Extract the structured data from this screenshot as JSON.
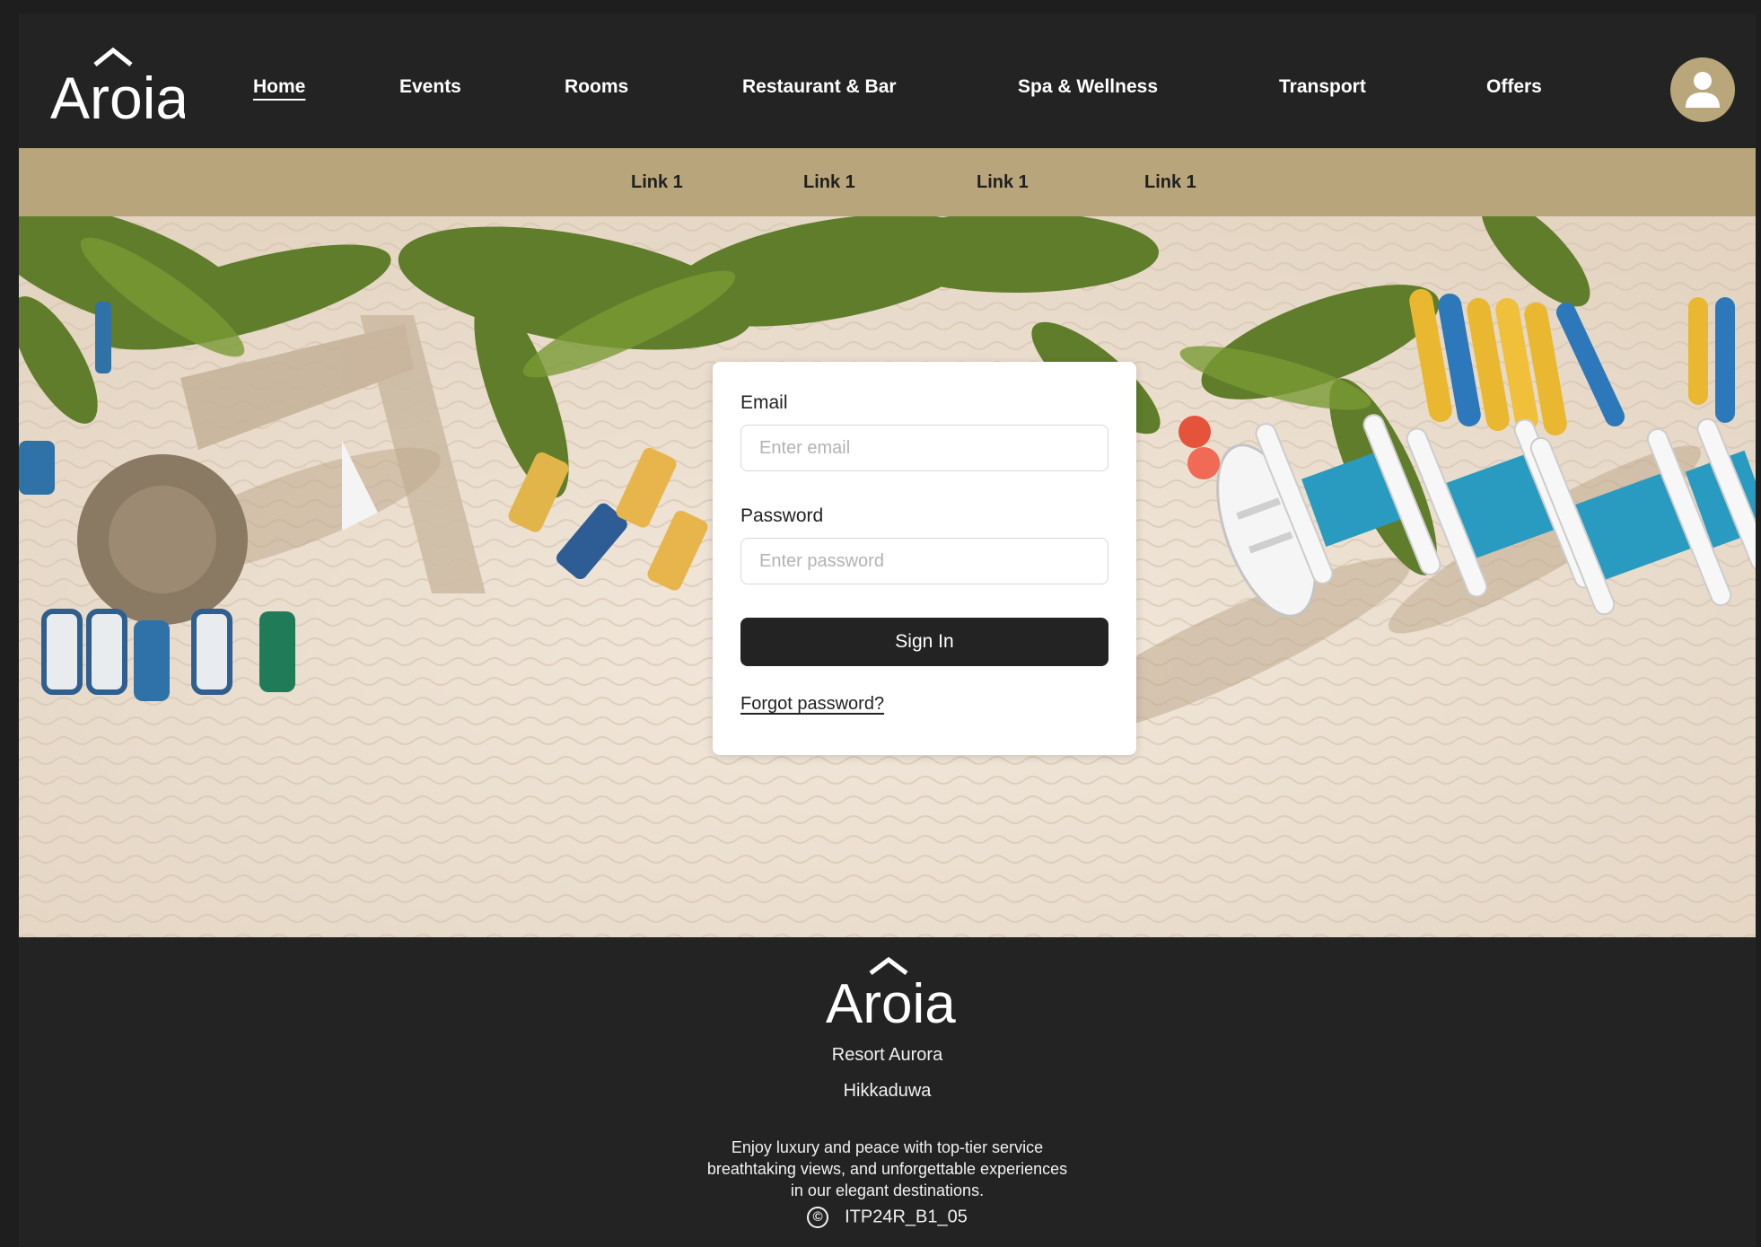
{
  "brand": {
    "logo_text": "Aroia"
  },
  "nav": {
    "items": [
      {
        "label": "Home",
        "active": true
      },
      {
        "label": "Events"
      },
      {
        "label": "Rooms"
      },
      {
        "label": "Restaurant & Bar"
      },
      {
        "label": "Spa & Wellness"
      },
      {
        "label": "Transport"
      },
      {
        "label": "Offers"
      }
    ],
    "avatar_icon": "user-icon"
  },
  "subnav": {
    "links": [
      {
        "label": "Link 1"
      },
      {
        "label": "Link 1"
      },
      {
        "label": "Link 1"
      },
      {
        "label": "Link 1"
      }
    ]
  },
  "login": {
    "email_label": "Email",
    "email_placeholder": "Enter email",
    "email_value": "",
    "password_label": "Password",
    "password_placeholder": "Enter password",
    "password_value": "",
    "signin_label": "Sign In",
    "forgot_label": "Forgot password?"
  },
  "footer": {
    "name": "Resort Aurora",
    "location": "Hikkaduwa",
    "description_lines": [
      "Enjoy luxury and peace with top-tier service",
      "breathtaking views, and unforgettable experiences",
      "in our elegant destinations."
    ],
    "copyright_symbol": "©",
    "copyright_text": "ITP24R_B1_05"
  },
  "colors": {
    "dark": "#232323",
    "gold": "#b8a57c",
    "white": "#ffffff"
  }
}
